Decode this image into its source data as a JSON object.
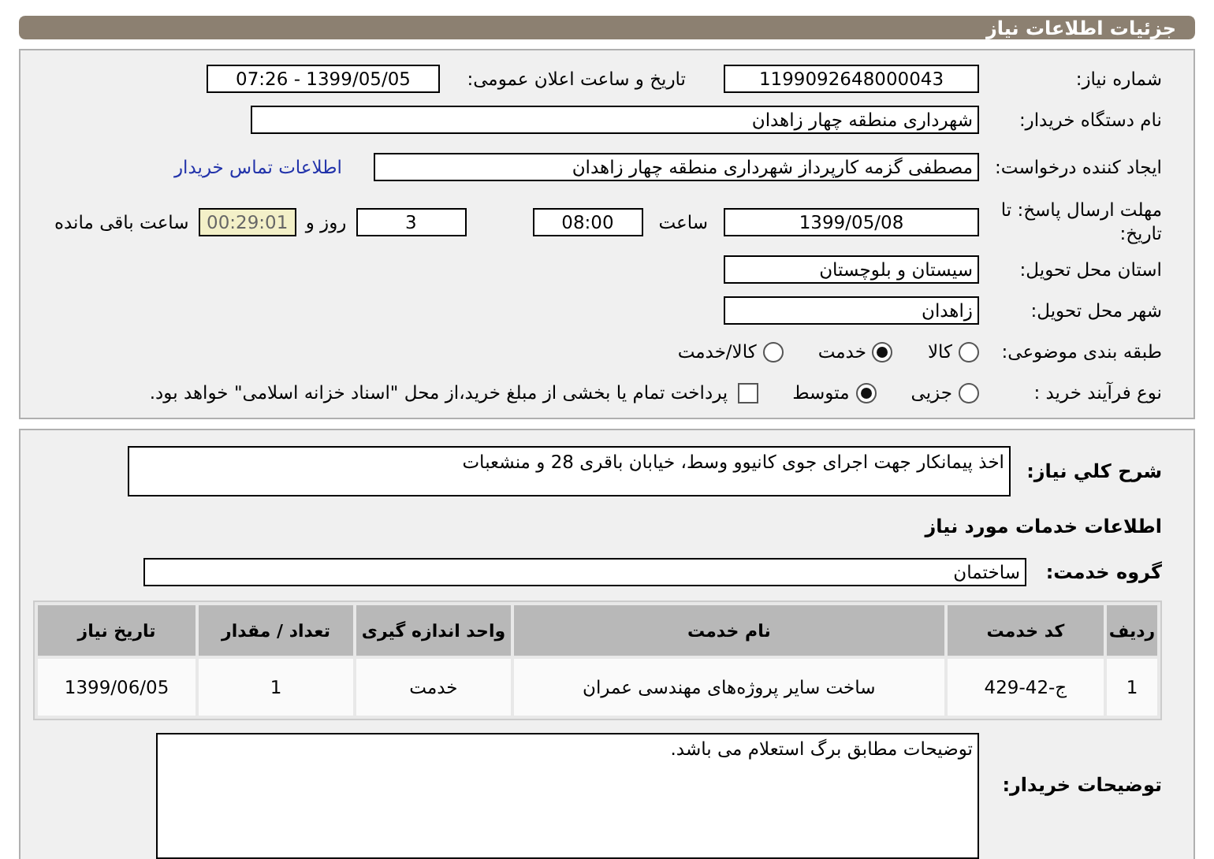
{
  "header": {
    "title": "جزئیات اطلاعات نیاز"
  },
  "need_number": {
    "label": "شماره نیاز:",
    "value": "1199092648000043"
  },
  "announce": {
    "label": "تاریخ و ساعت اعلان عمومی:",
    "value": "1399/05/05 - 07:26"
  },
  "buyer": {
    "label": "نام دستگاه خریدار:",
    "value": "شهرداری منطقه چهار زاهدان"
  },
  "creator": {
    "label": "ایجاد کننده درخواست:",
    "value": "مصطفی گزمه کارپرداز شهرداری منطقه چهار زاهدان",
    "link": "اطلاعات تماس خریدار"
  },
  "deadline": {
    "label": "مهلت ارسال پاسخ: تا تاریخ:",
    "date": "1399/05/08",
    "time_label": "ساعت",
    "time": "08:00",
    "days": "3",
    "days_label": "روز و",
    "remaining": "00:29:01",
    "remaining_label": "ساعت باقی مانده"
  },
  "province": {
    "label": "استان محل تحویل:",
    "value": "سیستان و بلوچستان"
  },
  "city": {
    "label": "شهر محل تحویل:",
    "value": "زاهدان"
  },
  "category": {
    "label": "طبقه بندی موضوعی:",
    "options": [
      {
        "label": "کالا",
        "selected": false
      },
      {
        "label": "خدمت",
        "selected": true
      },
      {
        "label": "کالا/خدمت",
        "selected": false
      }
    ]
  },
  "process": {
    "label": "نوع فرآیند خرید :",
    "options": [
      {
        "label": "جزیی",
        "selected": false
      },
      {
        "label": "متوسط",
        "selected": true
      }
    ],
    "payment": {
      "checked": false,
      "text": "پرداخت تمام یا بخشی از مبلغ خرید،از محل \"اسناد خزانه اسلامی\" خواهد بود."
    }
  },
  "description": {
    "label": "شرح کلي نياز:",
    "value": "اخذ پیمانکار جهت اجرای جوی کانیوو وسط، خیابان باقری 28 و منشعبات"
  },
  "services_heading": "اطلاعات خدمات مورد نياز",
  "service_group": {
    "label": "گروه خدمت:",
    "value": "ساختمان"
  },
  "table": {
    "columns": [
      "ردیف",
      "کد خدمت",
      "نام خدمت",
      "واحد اندازه گیری",
      "تعداد / مقدار",
      "تاریخ نیاز"
    ],
    "rows": [
      [
        "1",
        "ج-42-429",
        "ساخت سایر پروژه‌های مهندسی عمران",
        "خدمت",
        "1",
        "1399/06/05"
      ]
    ]
  },
  "buyer_notes": {
    "label": "توضیحات خریدار:",
    "value": "توضیحات مطابق برگ استعلام می باشد."
  }
}
